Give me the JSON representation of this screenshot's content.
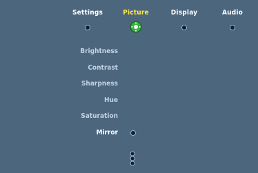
{
  "tabs": [
    {
      "label": "Settings",
      "active": false,
      "icon": "dot-indicator"
    },
    {
      "label": "Picture",
      "active": true,
      "icon": "selected-knob"
    },
    {
      "label": "Display",
      "active": false,
      "icon": "dot-indicator"
    },
    {
      "label": "Audio",
      "active": false,
      "icon": "dot-indicator"
    }
  ],
  "picture_menu": {
    "items": [
      {
        "label": "Brightness"
      },
      {
        "label": "Contrast"
      },
      {
        "label": "Sharpness"
      },
      {
        "label": "Hue"
      },
      {
        "label": "Saturation"
      },
      {
        "label": "Mirror",
        "selected": true
      }
    ]
  },
  "colors": {
    "background": "#4c667d",
    "active_tab": "#ffe84a",
    "knob_green": "#34b241",
    "label_text": "#c4d2e0",
    "selected_text": "#ffffff"
  },
  "icons": {
    "scroll_indicator": "scroll-down-icon"
  }
}
